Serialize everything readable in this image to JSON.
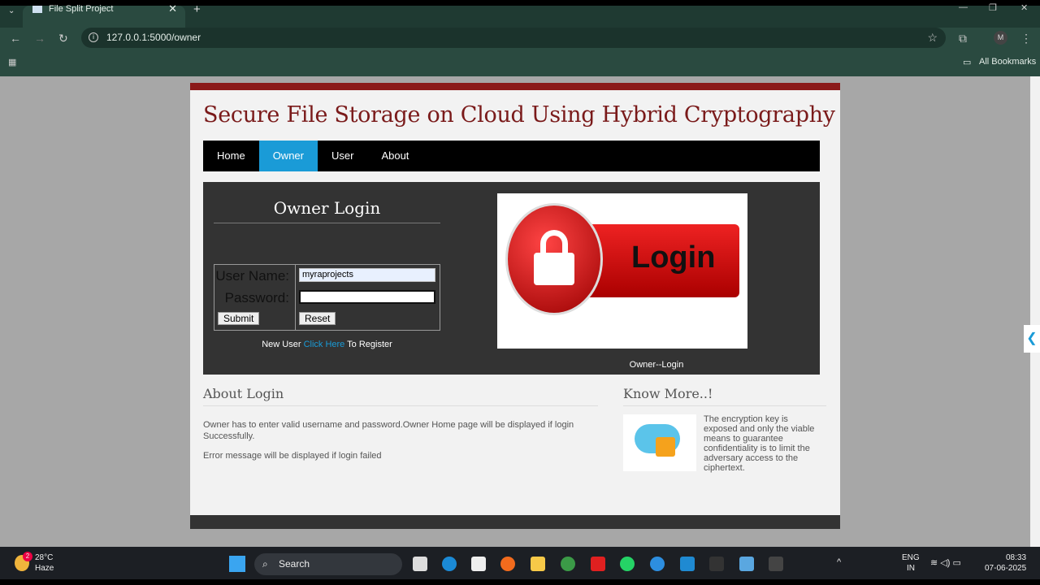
{
  "browser": {
    "tab_title": "File Split Project",
    "url": "127.0.0.1:5000/owner",
    "all_bookmarks": "All Bookmarks",
    "profile": "M"
  },
  "site": {
    "title": "Secure File Storage on Cloud Using Hybrid Cryptography",
    "menu": [
      {
        "label": "Home"
      },
      {
        "label": "Owner",
        "active": true
      },
      {
        "label": "User"
      },
      {
        "label": "About"
      }
    ],
    "login": {
      "heading": "Owner Login",
      "username_label": "User Name:",
      "username_value": "myraprojects",
      "password_label": "Password:",
      "password_value": "",
      "submit": "Submit",
      "reset": "Reset",
      "new_user": "New User",
      "click_here": "Click Here",
      "to_register": "To Register"
    },
    "image_text": "Login",
    "image_caption": "Owner--Login",
    "about": {
      "heading": "About Login",
      "p1": "Owner has to enter valid username and password.Owner Home page will be displayed if login Successfully.",
      "p2": "Error message will be displayed if login failed"
    },
    "know": {
      "heading": "Know More..!",
      "text": "The encryption key is exposed and only the viable means to guarantee confidentiality is to limit the adversary access to the ciphertext."
    }
  },
  "taskbar": {
    "temp": "28°C",
    "weather": "Haze",
    "weather_badge": "2",
    "search": "Search",
    "lang1": "ENG",
    "lang2": "IN",
    "time": "08:33",
    "date": "07-06-2025"
  }
}
